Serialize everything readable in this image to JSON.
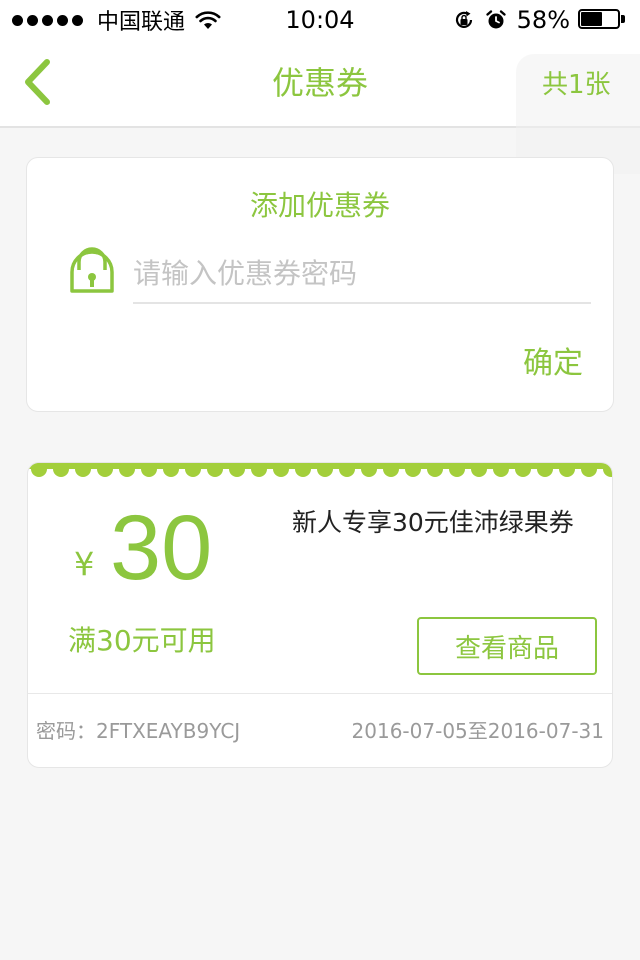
{
  "status_bar": {
    "carrier": "中国联通",
    "time": "10:04",
    "battery_percent": "58%",
    "battery_level": 0.58
  },
  "nav": {
    "title": "优惠券",
    "count_label": "共1张",
    "back_icon": "chevron-left-icon"
  },
  "add_coupon": {
    "title": "添加优惠券",
    "input_value": "",
    "input_placeholder": "请输入优惠券密码",
    "confirm_label": "确定",
    "icon": "lock-icon"
  },
  "coupons": [
    {
      "currency": "¥",
      "amount": "30",
      "condition": "满30元可用",
      "name": "新人专享30元佳沛绿果券",
      "button_label": "查看商品",
      "code": "密码：2FTXEAYB9YCJ",
      "validity": "2016-07-05至2016-07-31"
    }
  ],
  "colors": {
    "accent": "#8cc63f",
    "background": "#f6f6f6",
    "card": "#ffffff",
    "muted_text": "#9a9a9a"
  }
}
